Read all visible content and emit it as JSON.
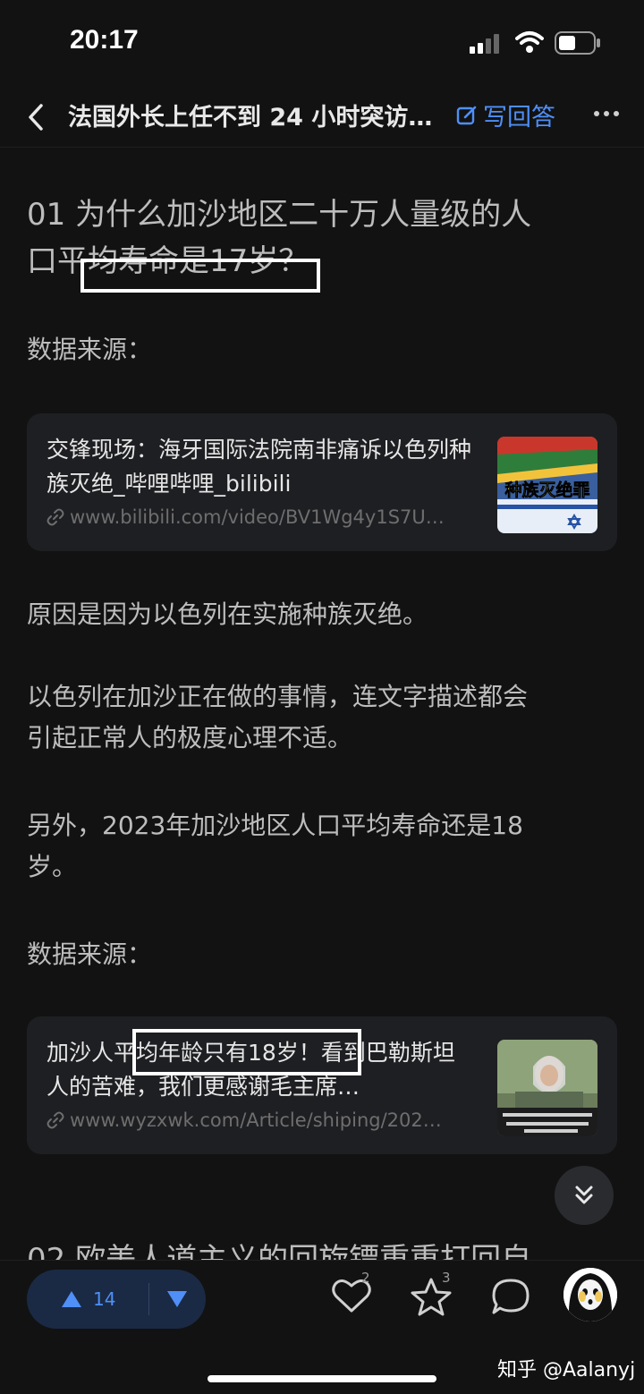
{
  "status": {
    "time": "20:17"
  },
  "nav": {
    "title": "法国外长上任不到 24 小时突访…",
    "write_answer": "写回答"
  },
  "article": {
    "heading_line1": "01 为什么加沙地区二十万人量级的人",
    "heading_line2": "口平均寿命是17岁？",
    "source1": "数据来源：",
    "card1": {
      "title": "交锋现场：海牙国际法院南非痛诉以色列种族灭绝_哔哩哔哩_bilibili",
      "url": "www.bilibili.com/video/BV1Wg4y1S7U…",
      "thumb_text": "种族灭绝罪"
    },
    "para1": "原因是因为以色列在实施种族灭绝。",
    "para2_line1": "以色列在加沙正在做的事情，连文字描述都会",
    "para2_line2": "引起正常人的极度心理不适。",
    "para3_line1": "另外，2023年加沙地区人口平均寿命还是18",
    "para3_line2": "岁。",
    "source2": "数据来源：",
    "card2": {
      "title": "加沙人平均年龄只有18岁！看到巴勒斯坦人的苦难，我们更感谢毛主席…",
      "url": "www.wyzxwk.com/Article/shiping/202…"
    },
    "next_heading": "02 欧美人道主义的回旋镖重重打回自"
  },
  "bottom": {
    "vote_count": "14",
    "like_count": "2",
    "fav_count": "3",
    "watermark": "知乎 @Aalanyj"
  },
  "colors": {
    "accent": "#4f8ff7",
    "background": "#121212",
    "card": "#1e1f22"
  }
}
